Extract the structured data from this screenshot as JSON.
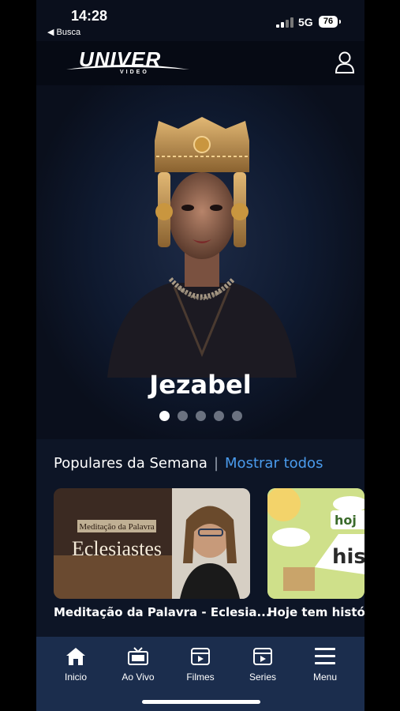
{
  "status": {
    "time": "14:28",
    "back_label": "◀ Busca",
    "network": "5G",
    "battery": "76"
  },
  "header": {
    "logo_text": "UNIVER",
    "logo_sub": "VIDEO"
  },
  "hero": {
    "title": "Jezabel",
    "active_slide": 1,
    "slide_count": 5
  },
  "popular": {
    "heading": "Populares da Semana",
    "separator": "|",
    "show_all": "Mostrar todos",
    "items": [
      {
        "title": "Meditação da Palavra - Eclesia...",
        "thumb_line1": "Meditação da Palavra",
        "thumb_line2": "Eclesiastes"
      },
      {
        "title": "Hoje tem históri",
        "thumb_line1": "hoj",
        "thumb_line2": "hist"
      }
    ]
  },
  "tabs": [
    {
      "label": "Inicio",
      "icon": "home-icon"
    },
    {
      "label": "Ao Vivo",
      "icon": "tv-icon"
    },
    {
      "label": "Filmes",
      "icon": "film-icon"
    },
    {
      "label": "Series",
      "icon": "series-icon"
    },
    {
      "label": "Menu",
      "icon": "menu-icon"
    }
  ]
}
